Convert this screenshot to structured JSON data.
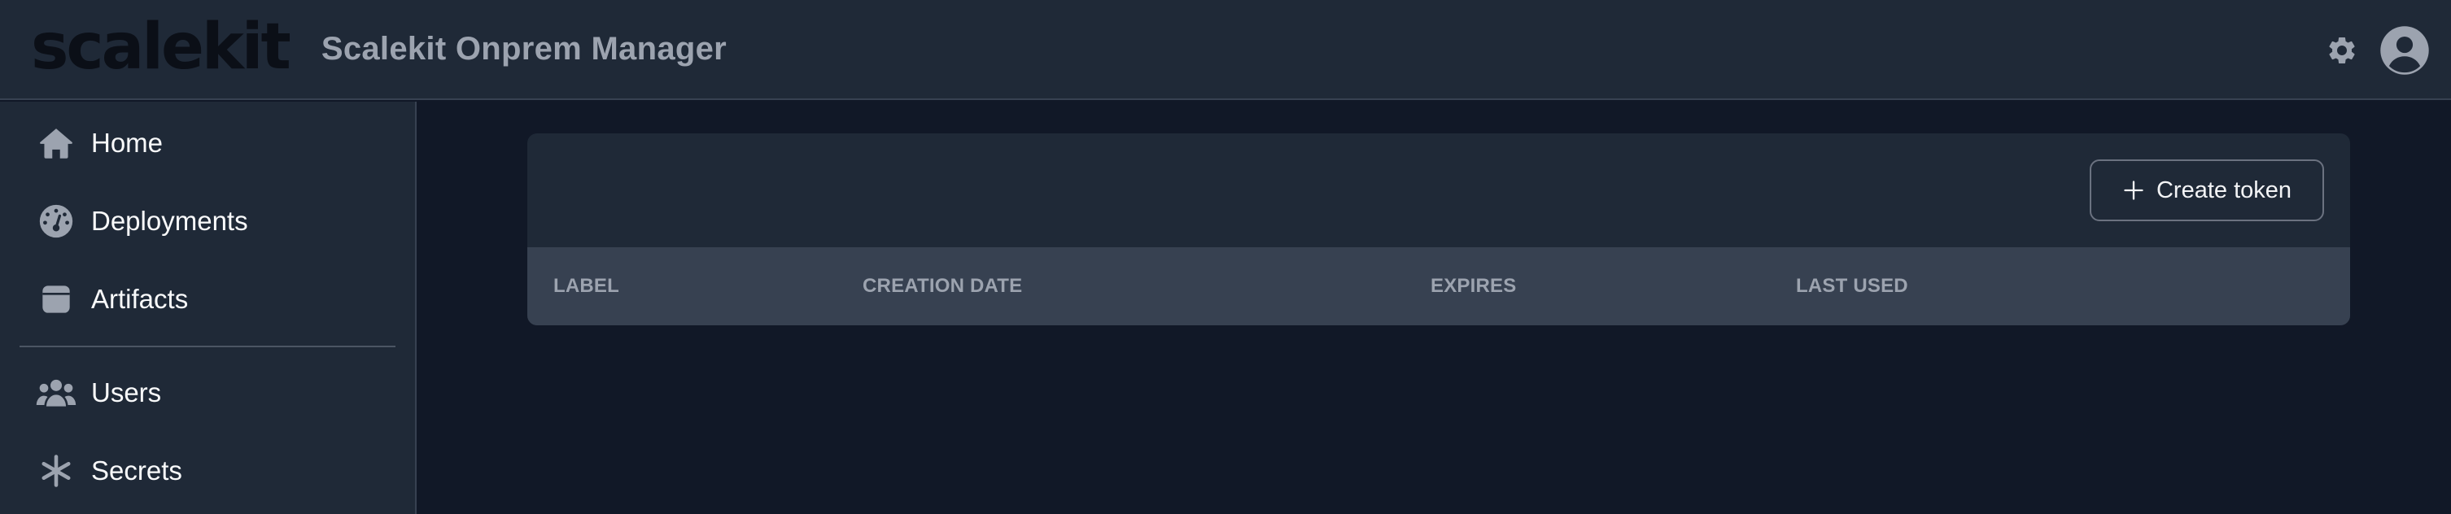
{
  "header": {
    "logo_text": "scalekit",
    "title": "Scalekit Onprem Manager",
    "settings_icon": "gear-icon",
    "account_icon": "user-circle-icon"
  },
  "sidebar": {
    "items": [
      {
        "label": "Home",
        "icon": "home-icon"
      },
      {
        "label": "Deployments",
        "icon": "dashboard-gauge-icon"
      },
      {
        "label": "Artifacts",
        "icon": "archive-box-icon"
      },
      {
        "label": "Users",
        "icon": "users-group-icon"
      },
      {
        "label": "Secrets",
        "icon": "asterisk-icon"
      }
    ]
  },
  "tokens": {
    "create_button_label": "Create token",
    "create_button_icon": "plus-icon",
    "columns": [
      "LABEL",
      "CREATION DATE",
      "EXPIRES",
      "LAST USED"
    ],
    "rows": []
  },
  "colors": {
    "page_bg": "#111827",
    "panel_bg": "#1f2937",
    "table_head_bg": "#374151",
    "muted_text": "#9ca3af",
    "border": "#374151"
  }
}
